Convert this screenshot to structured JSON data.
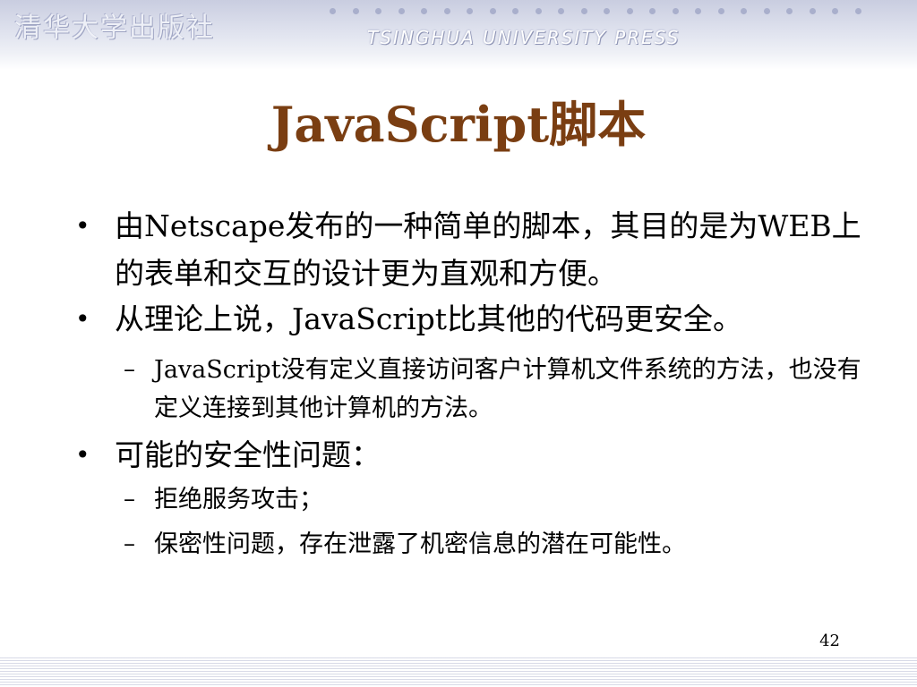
{
  "header": {
    "logo_text": "清华大学出版社",
    "press_text": "TSINGHUA UNIVERSITY PRESS",
    "brand_colors": {
      "banner": "#c9cde0",
      "dots": "#a9afcc",
      "title": "#7a3e12"
    }
  },
  "slide": {
    "title": "JavaScript脚本",
    "bullets": [
      {
        "level": 1,
        "marker": "•",
        "text": "由Netscape发布的一种简单的脚本，其目的是为WEB上的表单和交互的设计更为直观和方便。"
      },
      {
        "level": 1,
        "marker": "•",
        "text": "从理论上说，JavaScript比其他的代码更安全。"
      },
      {
        "level": 2,
        "marker": "–",
        "text": "JavaScript没有定义直接访问客户计算机文件系统的方法，也没有定义连接到其他计算机的方法。"
      },
      {
        "level": 1,
        "marker": "•",
        "text": "可能的安全性问题："
      },
      {
        "level": 2,
        "marker": "–",
        "text": "拒绝服务攻击；"
      },
      {
        "level": 2,
        "marker": "–",
        "text": "保密性问题，存在泄露了机密信息的潜在可能性。"
      }
    ],
    "page_number": "42"
  }
}
